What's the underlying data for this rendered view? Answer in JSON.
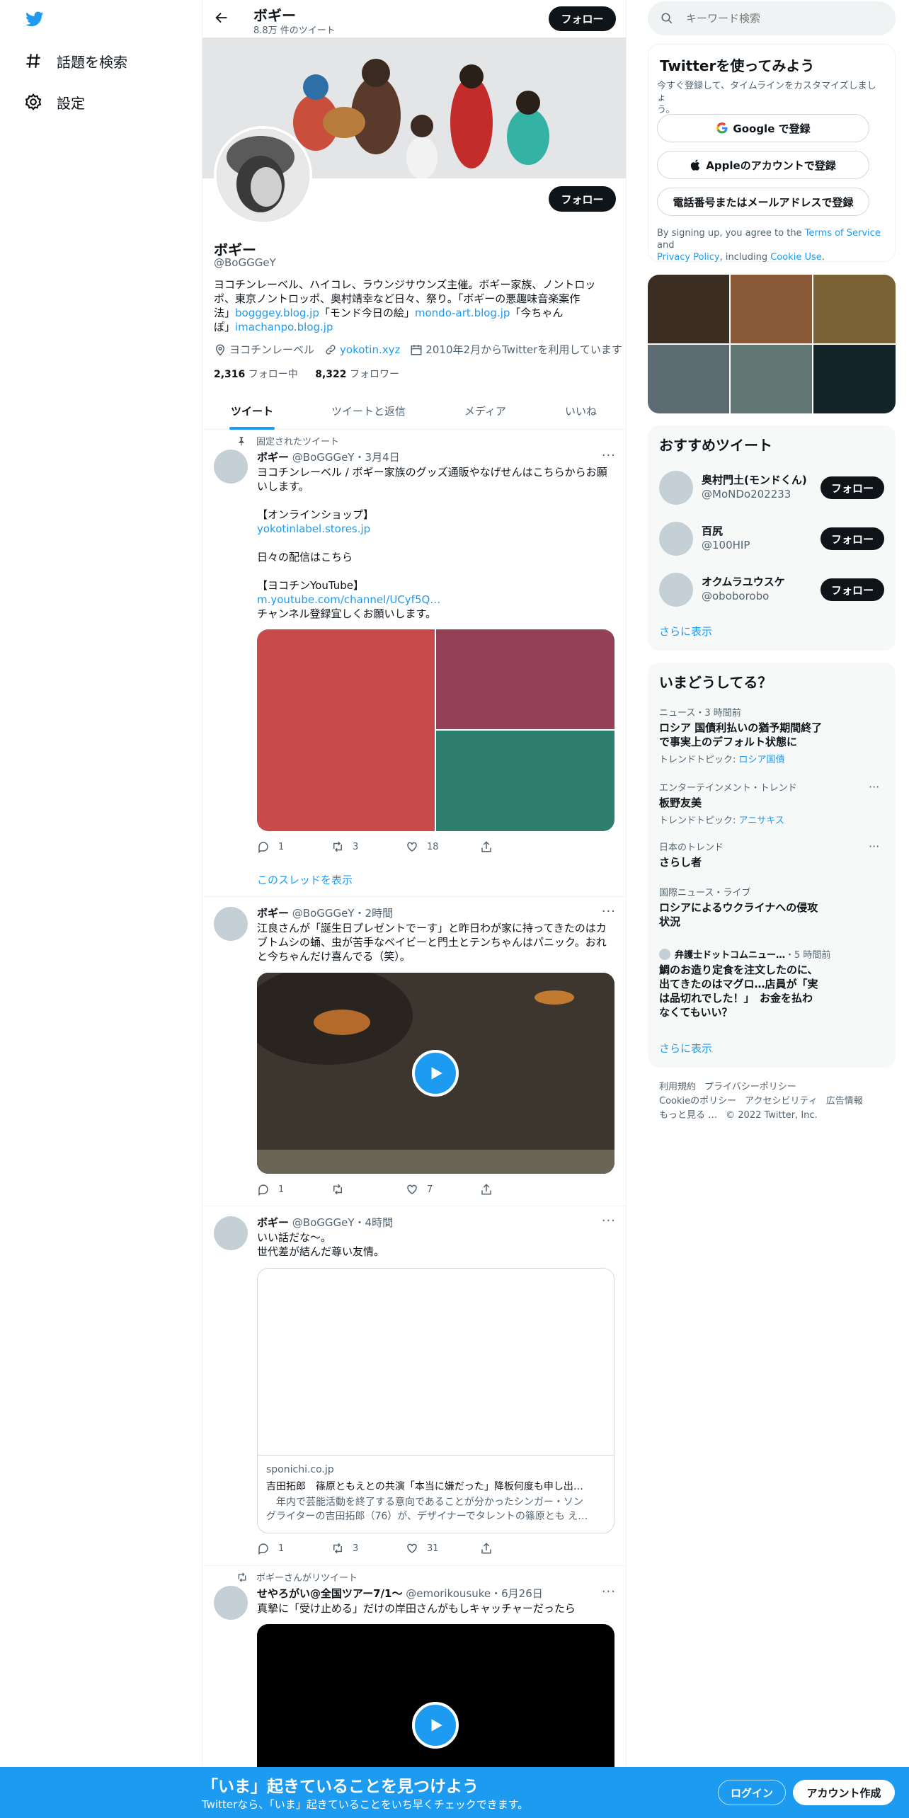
{
  "nav": {
    "explore": "話題を検索",
    "settings": "設定"
  },
  "profile": {
    "name": "ボギー",
    "tweet_count": "8.8万 件のツイート",
    "follow": "フォロー",
    "handle": "@BoGGGeY",
    "bio_line1": "ヨコチンレーベル、ハイコレ、ラウンジサウンズ主催。ボギー家族、ノントロッ",
    "bio_line2": "ポ、東京ノントロッポ、奥村靖幸など日々、祭り。「ボギーの悪趣味音楽案作",
    "bio_line3a": "法」",
    "bio_link1": "bogggey.blog.jp",
    "bio_line3b": "「モンド今日の絵」",
    "bio_link2": "mondo-art.blog.jp",
    "bio_line3c": "「今ちゃん",
    "bio_line4a": "ぽ」",
    "bio_link3": "imachanpo.blog.jp",
    "location": "ヨコチンレーベル",
    "website": "yokotin.xyz",
    "joined": "2010年2月からTwitterを利用しています",
    "following_count": "2,316",
    "following_label": "フォロー中",
    "followers_count": "8,322",
    "followers_label": "フォロワー"
  },
  "tabs": [
    "ツイート",
    "ツイートと返信",
    "メディア",
    "いいね"
  ],
  "tweets": [
    {
      "context": "固定されたツイート",
      "name": "ボギー",
      "handle": "@BoGGGeY",
      "time": "・3月4日",
      "lines": [
        "ヨコチンレーベル / ボギー家族のグッズ通販やなげせんはこちらからお願",
        "いします。",
        "【オンラインショップ】",
        "日々の配信はこちら",
        "【ヨコチンYouTube】",
        "チャンネル登録宜しくお願いします。"
      ],
      "link1": "yokotinlabel.stores.jp",
      "link2": "m.youtube.com/channel/UCyf5Q…",
      "replies": "1",
      "retweets": "3",
      "likes": "18",
      "show_thread": "このスレッドを表示"
    },
    {
      "name": "ボギー",
      "handle": "@BoGGGeY",
      "time": "・2時間",
      "lines": [
        "江良さんが「誕生日プレゼントでーす」と昨日わが家に持ってきたのはカ",
        "ブトムシの蛹、虫が苦手なベイビーと門土とテンちゃんはパニック。おれ",
        "と今ちゃんだけ喜んでる（笑）。"
      ],
      "replies": "1",
      "retweets": "",
      "likes": "7"
    },
    {
      "name": "ボギー",
      "handle": "@BoGGGeY",
      "time": "・4時間",
      "lines": [
        "いい話だな〜。",
        "世代差が結んだ尊い友情。"
      ],
      "card_domain": "sponichi.co.jp",
      "card_title": "吉田拓郎　篠原ともえとの共演「本当に嫌だった」降板何度も申し出…",
      "card_desc1": "　年内で芸能活動を終了する意向であることが分かったシンガー・ソン",
      "card_desc2": "グライターの吉田拓郎（76）が、デザイナーでタレントの篠原とも え…",
      "replies": "1",
      "retweets": "3",
      "likes": "31"
    },
    {
      "context": "ボギーさんがリツイート",
      "name": "せやろがい@全国ツアー7/1〜",
      "handle": "@emorikousuke",
      "time": "・6月26日",
      "lines": [
        "真摯に「受け止める」だけの岸田さんがもしキャッチャーだったら"
      ]
    }
  ],
  "search": {
    "placeholder": "キーワード検索"
  },
  "signup": {
    "title": "Twitterを使ってみよう",
    "subtitle1": "今すぐ登録して、タイムラインをカスタマイズしましょ",
    "subtitle2": "う。",
    "google": "Google で登録",
    "apple": "Appleのアカウントで登録",
    "phone": "電話番号またはメールアドレスで登録",
    "legal_a": "By signing up, you agree to the ",
    "terms": "Terms of Service",
    "legal_b": " and",
    "privacy": "Privacy Policy",
    "legal_c": ", including ",
    "cookie": "Cookie Use",
    "legal_d": "."
  },
  "who_to_follow": {
    "title": "おすすめツイート",
    "users": [
      {
        "name": "奥村門土(モンドくん)",
        "handle": "@MoNDo202233"
      },
      {
        "name": "百尻",
        "handle": "@100HIP"
      },
      {
        "name": "オクムラユウスケ",
        "handle": "@oboborobo"
      }
    ],
    "follow": "フォロー",
    "more": "さらに表示"
  },
  "trends": {
    "title": "いまどうしてる？",
    "items": [
      {
        "meta": "ニュース・3 時間前",
        "title1": "ロシア 国債利払いの猶予期間終了",
        "title2": "で事実上のデフォルト状態に",
        "sub_label": "トレンドトピック: ",
        "sub_link": "ロシア国債"
      },
      {
        "meta": "エンターテインメント・トレンド",
        "title1": "板野友美",
        "sub_label": "トレンドトピック: ",
        "sub_link": "アニサキス"
      },
      {
        "meta": "日本のトレンド",
        "title1": "さらし者"
      },
      {
        "meta": "国際ニュース・ライブ",
        "title1": "ロシアによるウクライナへの侵攻",
        "title2": "状況"
      },
      {
        "meta_name": "弁護士ドットコムニュー…",
        "meta": "・5 時間前",
        "title1": "鯛のお造り定食を注文したのに、",
        "title2": "出てきたのはマグロ…店員が「実",
        "title3": "は品切れでした！」　お金を払わ",
        "title4": "なくてもいい？"
      }
    ],
    "more": "さらに表示"
  },
  "footer": {
    "links1": [
      "利用規約",
      "プライバシーポリシー"
    ],
    "links2": [
      "Cookieのポリシー",
      "アクセシビリティ",
      "広告情報"
    ],
    "more": "もっと見る …",
    "copyright": "© 2022 Twitter, Inc."
  },
  "bottom_bar": {
    "title": "「いま」起きていることを見つけよう",
    "subtitle": "Twitterなら、「いま」起きていることをいち早くチェックできます。",
    "login": "ログイン",
    "signup": "アカウント作成"
  },
  "colors": {
    "accent": "#1d9bf0",
    "dark": "#0f1419",
    "grey": "#536471",
    "bg_card": "#f7f9f9"
  }
}
